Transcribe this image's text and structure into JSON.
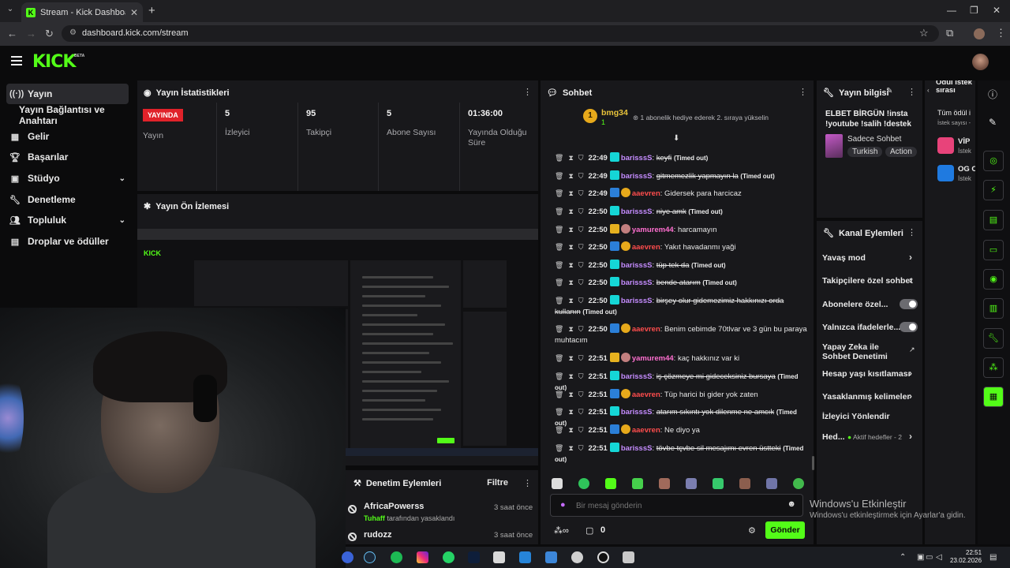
{
  "browser": {
    "tab_title": "Stream - Kick Dashboard",
    "url": "dashboard.kick.com/stream"
  },
  "brand": {
    "logo": "KICK",
    "beta": "BETA",
    "accent": "#53fc18"
  },
  "sidebar": {
    "items": [
      {
        "label": "Yayın",
        "icon": "broadcast-icon",
        "active": true
      },
      {
        "label": "Yayın Bağlantısı ve Anahtarı"
      },
      {
        "label": "Gelir",
        "icon": "chart-icon"
      },
      {
        "label": "Başarılar",
        "icon": "trophy-icon"
      },
      {
        "label": "Stüdyo",
        "icon": "studio-icon",
        "expandable": true
      },
      {
        "label": "Denetleme",
        "icon": "wrench-icon"
      },
      {
        "label": "Topluluk",
        "icon": "community-icon",
        "expandable": true
      },
      {
        "label": "Droplar ve ödüller",
        "icon": "gift-icon"
      }
    ]
  },
  "stats": {
    "title": "Yayın İstatistikleri",
    "live_badge": "YAYINDA",
    "status_label": "Yayın",
    "columns": [
      {
        "value": "5",
        "label": "İzleyici"
      },
      {
        "value": "95",
        "label": "Takipçi"
      },
      {
        "value": "5",
        "label": "Abone Sayısı"
      },
      {
        "value": "01:36:00",
        "label": "Yayında Olduğu Süre"
      }
    ]
  },
  "preview": {
    "title": "Yayın Ön İzlemesi"
  },
  "moderation": {
    "title": "Denetim Eylemleri",
    "filter": "Filtre",
    "rows": [
      {
        "user": "AfricaPowerss",
        "by": "Tuhaff",
        "action": "tarafından yasaklandı",
        "time": "3 saat önce"
      },
      {
        "user": "rudozz",
        "time": "3 saat önce"
      }
    ]
  },
  "chat": {
    "title": "Sohbet",
    "pinned": {
      "rank": "1",
      "user": "bmg34",
      "count": "1",
      "message": "1 abonelik hediye ederek 2. sıraya yükselin"
    },
    "messages": [
      {
        "time": "22:49",
        "user": "barisssS",
        "text": "keyfi",
        "timed_out": true
      },
      {
        "time": "22:49",
        "user": "barisssS",
        "text": "gitmemezlik yapmayın la",
        "timed_out": true
      },
      {
        "time": "22:49",
        "user": "aaevren",
        "text": "Gidersek para harcicaz"
      },
      {
        "time": "22:50",
        "user": "barisssS",
        "text": "niye amk",
        "timed_out": true
      },
      {
        "time": "22:50",
        "user": "yamurem44",
        "text": "harcamayın"
      },
      {
        "time": "22:50",
        "user": "aaevren",
        "text": "Yakıt havadanmı yaği"
      },
      {
        "time": "22:50",
        "user": "barisssS",
        "text": "tüp tek da",
        "timed_out": true
      },
      {
        "time": "22:50",
        "user": "barisssS",
        "text": "bende atarım",
        "timed_out": true
      },
      {
        "time": "22:50",
        "user": "barisssS",
        "text": "birşey olur gidemezimiz hakkınızı orda kullanın",
        "timed_out": true
      },
      {
        "time": "22:50",
        "user": "aaevren",
        "text": "Benim cebimde 70tlvar ve 3 gün bu paraya muhtacım"
      },
      {
        "time": "22:51",
        "user": "yamurem44",
        "text": "kaç hakkınız var ki"
      },
      {
        "time": "22:51",
        "user": "barisssS",
        "text": "iş çözmeye mi gideceksiniz bursaya",
        "timed_out": true
      },
      {
        "time": "22:51",
        "user": "aaevren",
        "text": "Tüp harici bi gider yok zaten"
      },
      {
        "time": "22:51",
        "user": "barisssS",
        "text": "atarım sıkıntı yok dilenme ne amcık",
        "timed_out": true
      },
      {
        "time": "22:51",
        "user": "aaevren",
        "text": "Ne diyo ya"
      },
      {
        "time": "22:51",
        "user": "barisssS",
        "text": "tövbe tçvbe sil mesajımı evren üstteki",
        "timed_out": true
      }
    ],
    "timed_out_label": "(Timed out)",
    "input_placeholder": "Bir mesaj gönderin",
    "points": "0",
    "send_label": "Gönder"
  },
  "stream_info": {
    "title": "Yayın bilgisi",
    "stream_title": "ELBET BİRGÜN !insta !youtube !salih !destek",
    "category": "Sadece Sohbet",
    "tags": [
      "Turkish",
      "Action"
    ]
  },
  "channel_actions": {
    "title": "Kanal Eylemleri",
    "items": [
      {
        "label": "Yavaş mod",
        "control": "chevron"
      },
      {
        "label": "Takipçilere özel sohbet",
        "control": "chevron"
      },
      {
        "label": "Abonelere özel...",
        "control": "toggle"
      },
      {
        "label": "Yalnızca ifadelerle...",
        "control": "toggle"
      },
      {
        "label": "Yapay Zeka ile Sohbet Denetimi",
        "control": "external"
      },
      {
        "label": "Hesap yaşı kısıtlaması",
        "control": "chevron"
      },
      {
        "label": "Yasaklanmış kelimeler",
        "control": "chevron"
      },
      {
        "label": "İzleyici Yönlendir",
        "control": "none"
      },
      {
        "label": "Hed...",
        "control": "chevron",
        "extra": "Aktif hedefler - 2"
      }
    ]
  },
  "reward_queue": {
    "title": "Ödül istek sırası",
    "subtitle": "Tüm ödül i",
    "sub2": "İstek sayısı -",
    "items": [
      {
        "label": "VİP",
        "sub": "İstek"
      },
      {
        "label": "OG C",
        "sub": "İstek"
      }
    ]
  },
  "windows": {
    "activate_title": "Windows'u Etkinleştir",
    "activate_sub": "Windows'u etkinleştirmek için Ayarlar'a gidin.",
    "time": "22:51",
    "date": "23.02.2026"
  }
}
